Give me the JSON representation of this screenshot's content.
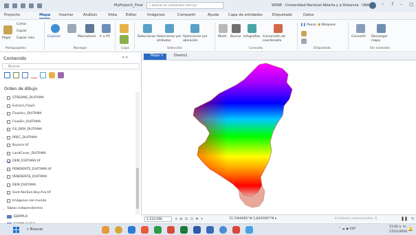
{
  "app": {
    "project_name": "MyProject1_Final",
    "search_placeholder": "Buscar en comandos (Alt+Q)",
    "user_org": "WSNE · Universidad Nacional Abierta y a Distancia · UNAD",
    "win_min": "–",
    "win_help": "?",
    "win_restore": "□"
  },
  "ribbon_tabs": [
    {
      "label": "Proyecto"
    },
    {
      "label": "Mapa"
    },
    {
      "label": "Insertar"
    },
    {
      "label": "Análisis"
    },
    {
      "label": "Vista"
    },
    {
      "label": "Editar"
    },
    {
      "label": "Imágenes"
    },
    {
      "label": "Compartir"
    },
    {
      "label": "Ayuda"
    },
    {
      "label": "Capa de entidades"
    },
    {
      "label": "Etiquetado"
    },
    {
      "label": "Datos"
    }
  ],
  "ribbon": {
    "clipboard": {
      "cut": "Cortar",
      "copy": "Copiar",
      "paste": "Pegar",
      "copy_path": "Copiar ruta",
      "group": "Portapapeles"
    },
    "navigate": {
      "explore": "Explorar",
      "bookmarks": "Marcadores",
      "goto": "Ir a XY",
      "group": "Navegar"
    },
    "layer": {
      "group": "Capa"
    },
    "selection": {
      "select": "Seleccionar",
      "by_attr": "Seleccionar por atributos",
      "by_loc": "Seleccionar por ubicación",
      "group": "Selección"
    },
    "inquiry": {
      "measure": "Medir",
      "find": "Buscar",
      "infographics": "Infografías",
      "convert_coords": "Conversión de coordenada",
      "group": "Consulta"
    },
    "labeling": {
      "pause": "Pausa",
      "lock": "Bloquear",
      "group": "Etiquetado"
    },
    "offline": {
      "convert": "Convertir",
      "download": "Descargar mapa",
      "group": "Sin conexión"
    }
  },
  "contents": {
    "title": "Contenido",
    "pin": "▾ ✕",
    "search_placeholder": "Buscar",
    "draw_order": "Orden de dibujo",
    "layers": [
      {
        "name": "STREAMS_DUITAMA",
        "checked": false,
        "expanded": false
      },
      {
        "name": "Extract_Flow1",
        "checked": false,
        "expanded": false
      },
      {
        "name": "FlowAcc_DUITAMA",
        "checked": false,
        "expanded": false
      },
      {
        "name": "FlowDir_DUITAMA",
        "checked": false,
        "expanded": false
      },
      {
        "name": "Fill_DEM_DUITAMA",
        "checked": false,
        "expanded": false
      },
      {
        "name": "PREC_DUITAMA",
        "checked": false,
        "expanded": false
      },
      {
        "name": "Boyaca.tif",
        "checked": false,
        "expanded": false
      },
      {
        "name": "LandCover_DUITAMA",
        "checked": false,
        "expanded": false
      },
      {
        "name": "DEM_DUITAMA.tif",
        "checked": true,
        "expanded": false
      },
      {
        "name": "PENDIENTE_DUITAMA.tif",
        "checked": false,
        "expanded": false
      },
      {
        "name": "PENDIENTE_DUITAMA",
        "checked": false,
        "expanded": false
      },
      {
        "name": "DEM_DUITAMA",
        "checked": false,
        "expanded": false
      },
      {
        "name": "Sant-NorSan-Boy-Ara.tif",
        "checked": false,
        "expanded": false
      },
      {
        "name": "Imágenes del mundo",
        "checked": false,
        "expanded": false
      }
    ],
    "standalone_tables_label": "Tablas independientes",
    "tables": [
      {
        "name": "EJEMPLO"
      },
      {
        "name": "EJEMPLO.CSV"
      }
    ]
  },
  "map": {
    "tabs": [
      {
        "label": "Mapa",
        "close": "✕",
        "active": true
      },
      {
        "label": "Diseño1",
        "active": false
      }
    ],
    "scale": "1:233.596",
    "status_tools": "▾ ⊞ ⊟ ⊡ ✚ ▾",
    "coordinates": "72,7940065°W 5,8205097°N ▾",
    "selected_features": "Entidades seleccionadas: 0",
    "pause": "❚❚",
    "refresh": "↻",
    "colors": {
      "high": "#ff00ff",
      "mid_high": "#0000ff",
      "mid": "#00ff00",
      "mid_low": "#ffff00",
      "low": "#ff0000",
      "outlet": "#e8a89a"
    }
  },
  "taskbar": {
    "search_placeholder": "Buscar",
    "tray": "⌃ ☁ ◉ ESP",
    "time": "11:02 a. m.",
    "date": "17/11/2024",
    "bell": "🔔"
  }
}
